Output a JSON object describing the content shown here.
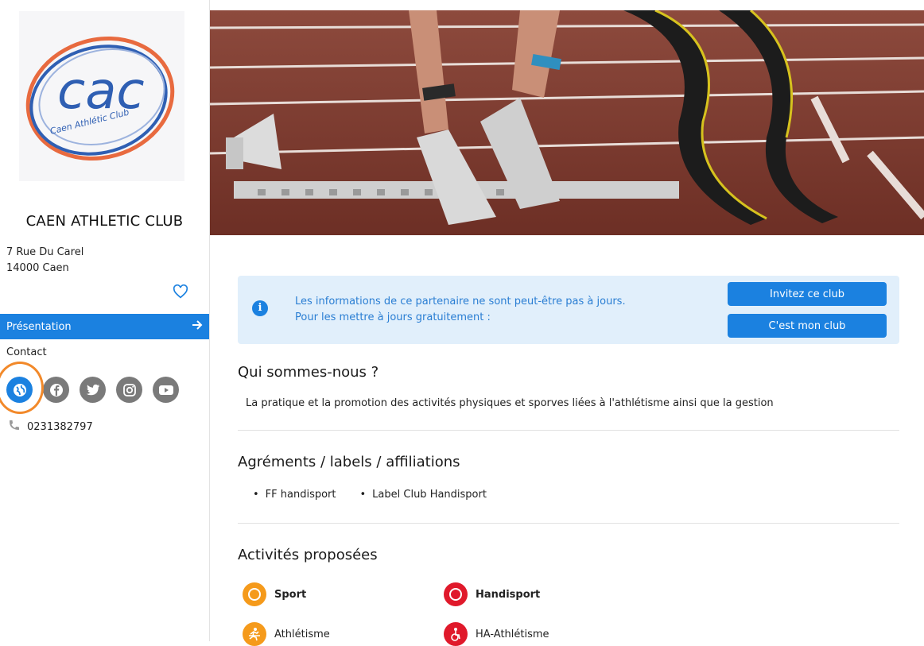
{
  "club": {
    "name": "CAEN ATHLETIC CLUB",
    "address_line1": "7 Rue Du Carel",
    "address_line2": "14000 Caen",
    "phone": "0231382797",
    "logo_text": "cac",
    "logo_subtext": "Caen Athlétic Club"
  },
  "sidebar": {
    "nav_active": "Présentation",
    "nav_contact": "Contact",
    "socials": [
      "website-icon",
      "facebook-icon",
      "twitter-icon",
      "instagram-icon",
      "youtube-icon"
    ]
  },
  "info_banner": {
    "line1": "Les informations de ce partenaire ne sont peut-être pas à jours.",
    "line2": "Pour les mettre à jours gratuitement :",
    "invite_label": "Invitez ce club",
    "claim_label": "C'est mon club"
  },
  "sections": {
    "about_title": "Qui sommes-nous ?",
    "about_text": "La pratique et la promotion des activités physiques et sporves liées à l'athlétisme ainsi que la gestion",
    "labels_title": "Agréments / labels / affiliations",
    "labels": [
      "FF handisport",
      "Label Club Handisport"
    ],
    "activities_title": "Activités proposées"
  },
  "activities": [
    {
      "label": "Sport",
      "icon": "sport-icon"
    },
    {
      "label": "Handisport",
      "icon": "handisport-icon"
    },
    {
      "label": "Athlétisme",
      "icon": "athletics-icon"
    },
    {
      "label": "HA-Athlétisme",
      "icon": "ha-athletics-icon"
    }
  ],
  "colors": {
    "accent": "#1b81e0",
    "highlight_ring": "#f2892a",
    "sport_orange": "#f59a1b",
    "handisport_red": "#e0192b",
    "banner_bg": "#e1effb"
  }
}
